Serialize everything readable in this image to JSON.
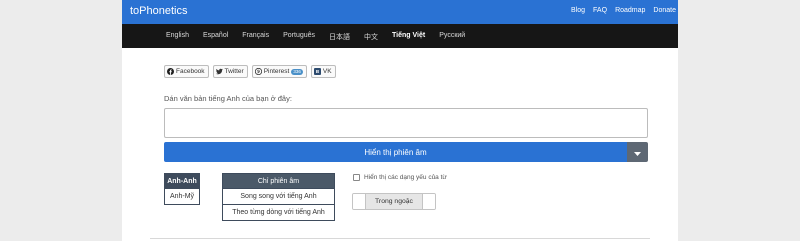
{
  "header": {
    "brand": "toPhonetics",
    "links": [
      "Blog",
      "FAQ",
      "Roadmap",
      "Donate"
    ]
  },
  "languages": [
    {
      "label": "English",
      "active": false
    },
    {
      "label": "Español",
      "active": false
    },
    {
      "label": "Français",
      "active": false
    },
    {
      "label": "Português",
      "active": false
    },
    {
      "label": "日本語",
      "active": false
    },
    {
      "label": "中文",
      "active": false
    },
    {
      "label": "Tiếng Việt",
      "active": true
    },
    {
      "label": "Русский",
      "active": false
    }
  ],
  "share": {
    "facebook": "Facebook",
    "twitter": "Twitter",
    "pinterest": "Pinterest",
    "pinterest_count": "336",
    "vk": "VK"
  },
  "main": {
    "prompt": "Dán văn bản tiếng Anh của bạn ở đây:",
    "textarea_value": "",
    "submit_label": "Hiển thị phiên âm"
  },
  "dialect": {
    "options": [
      "Anh-Anh",
      "Anh-Mỹ"
    ],
    "selected": "Anh-Anh"
  },
  "display_mode": {
    "options": [
      "Chỉ phiên âm",
      "Song song với tiếng Anh",
      "Theo từng dòng với tiếng Anh"
    ],
    "selected": "Chỉ phiên âm"
  },
  "weak_forms": {
    "label": "Hiển thị các dạng yếu của từ",
    "checked": false
  },
  "brackets": {
    "label": "Trong ngoặc"
  },
  "colors": {
    "primary": "#2a72d3",
    "langbar": "#161616",
    "dark_toggle": "#3e4b5c"
  }
}
